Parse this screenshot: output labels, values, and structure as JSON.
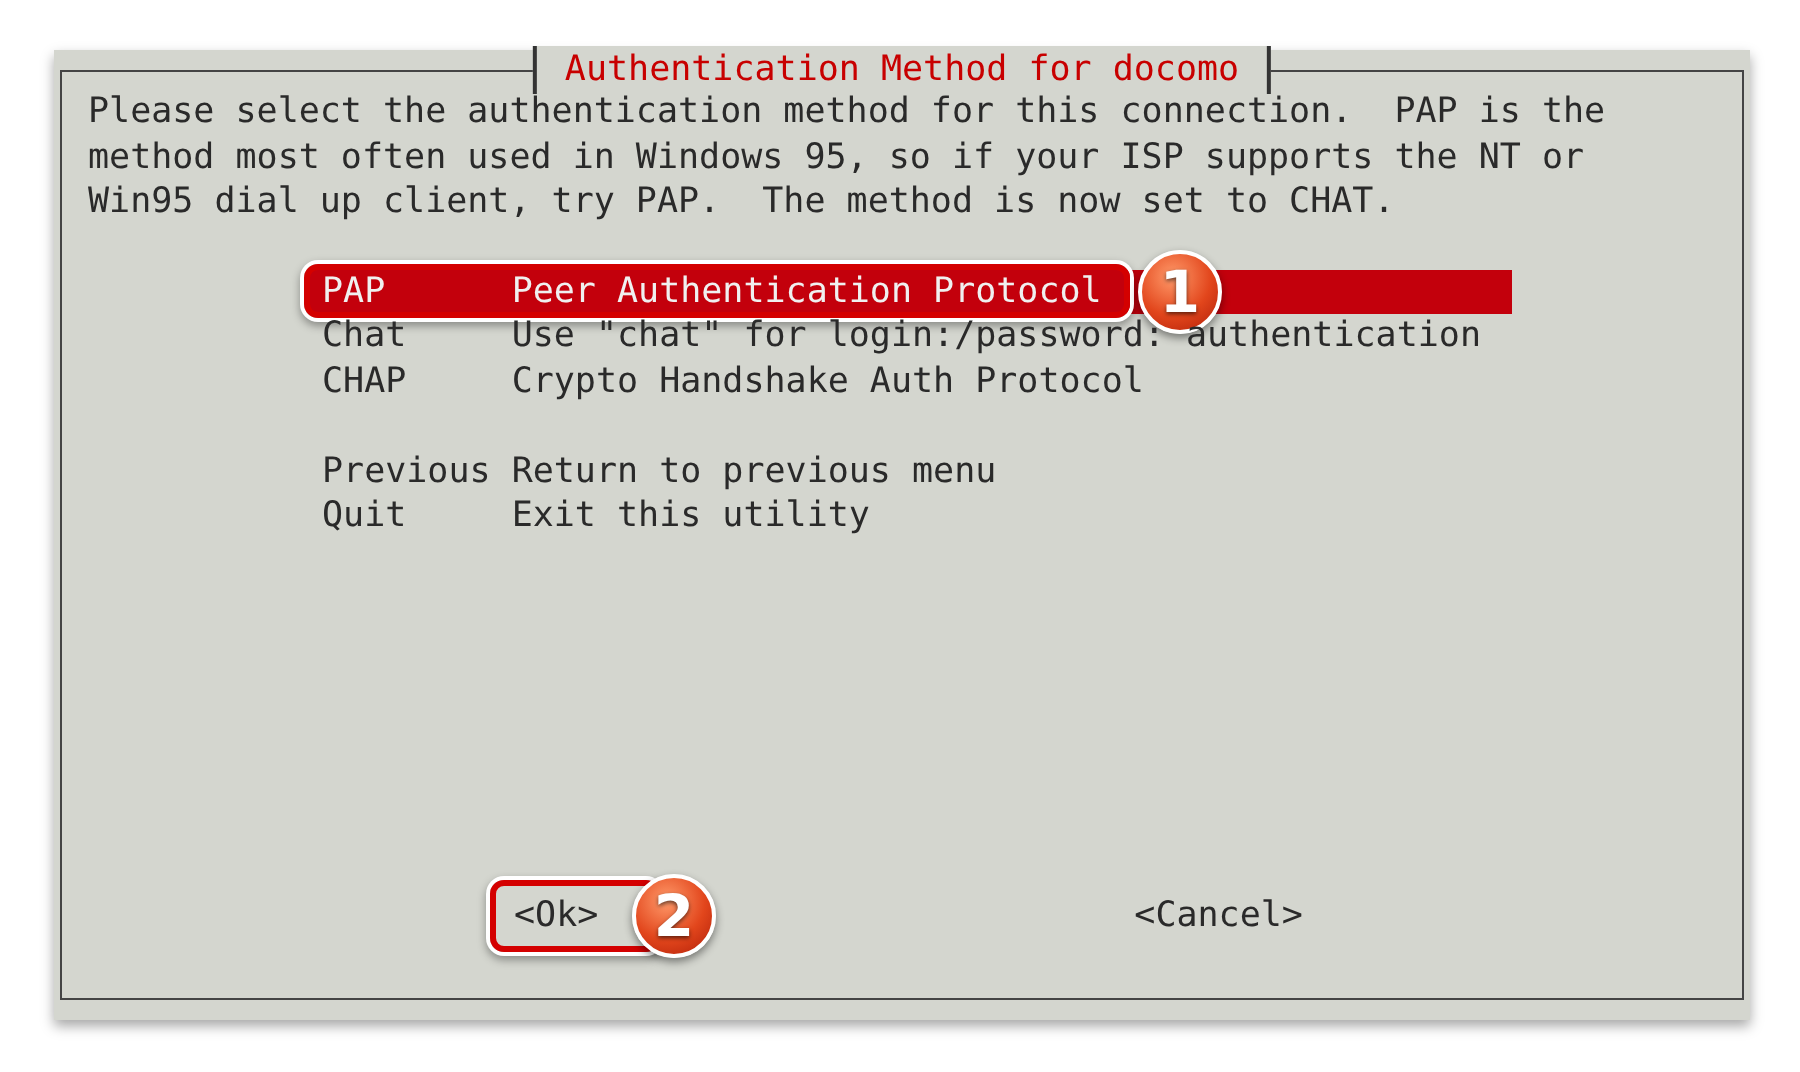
{
  "dialog": {
    "title": "Authentication Method for docomo",
    "message": "Please select the authentication method for this connection.  PAP is the method most often used in Windows 95, so if your ISP supports the NT or Win95 dial up client, try PAP.  The method is now set to CHAT.",
    "menu": [
      {
        "tag": "PAP",
        "description": "Peer Authentication Protocol",
        "selected": true,
        "callout": "1"
      },
      {
        "tag": "Chat",
        "description": "Use \"chat\" for login:/password: authentication",
        "selected": false
      },
      {
        "tag": "CHAP",
        "description": "Crypto Handshake Auth Protocol",
        "selected": false
      },
      {
        "kind": "blank"
      },
      {
        "tag": "Previous",
        "description": "Return to previous menu",
        "selected": false
      },
      {
        "tag": "Quit",
        "description": "Exit this utility",
        "selected": false
      }
    ],
    "buttons": [
      {
        "label": "<Ok>",
        "callout": "2"
      },
      {
        "label": "<Cancel>"
      }
    ]
  }
}
